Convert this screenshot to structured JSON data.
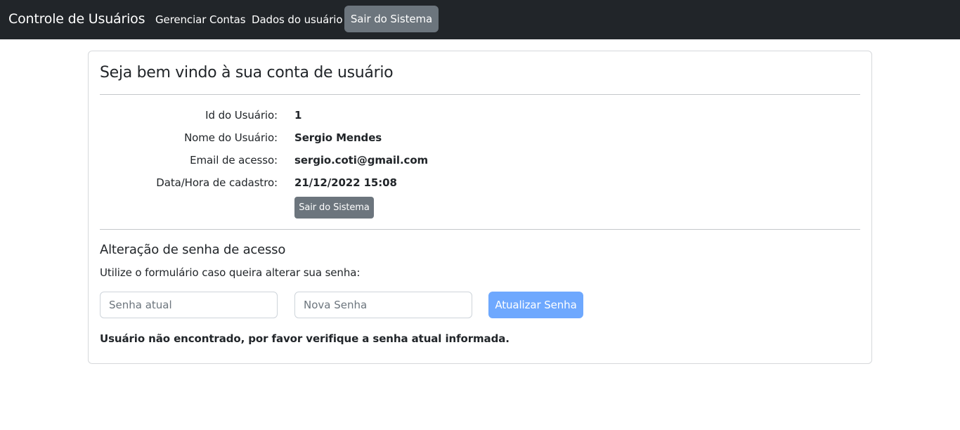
{
  "navbar": {
    "brand": "Controle de Usuários",
    "links": [
      "Gerenciar Contas",
      "Dados do usuário"
    ],
    "logout_button": "Sair do Sistema"
  },
  "card": {
    "title": "Seja bem vindo à sua conta de usuário",
    "fields": [
      {
        "label": "Id do Usuário:",
        "value": "1"
      },
      {
        "label": "Nome do Usuário:",
        "value": "Sergio Mendes"
      },
      {
        "label": "Email de acesso:",
        "value": "sergio.coti@gmail.com"
      },
      {
        "label": "Data/Hora de cadastro:",
        "value": "21/12/2022 15:08"
      }
    ],
    "logout_button": "Sair do Sistema"
  },
  "password_form": {
    "title": "Alteração de senha de acesso",
    "subtitle": "Utilize o formulário caso queira alterar sua senha:",
    "current_password": {
      "placeholder": "Senha atual",
      "value": ""
    },
    "new_password": {
      "placeholder": "Nova Senha",
      "value": ""
    },
    "submit_button": "Atualizar Senha",
    "message": "Usuário não encontrado, por favor verifique a senha atual informada."
  },
  "colors": {
    "navbar_bg": "#212529",
    "secondary_button": "#6c757d",
    "primary_button_disabled": "#6ea8fe"
  }
}
